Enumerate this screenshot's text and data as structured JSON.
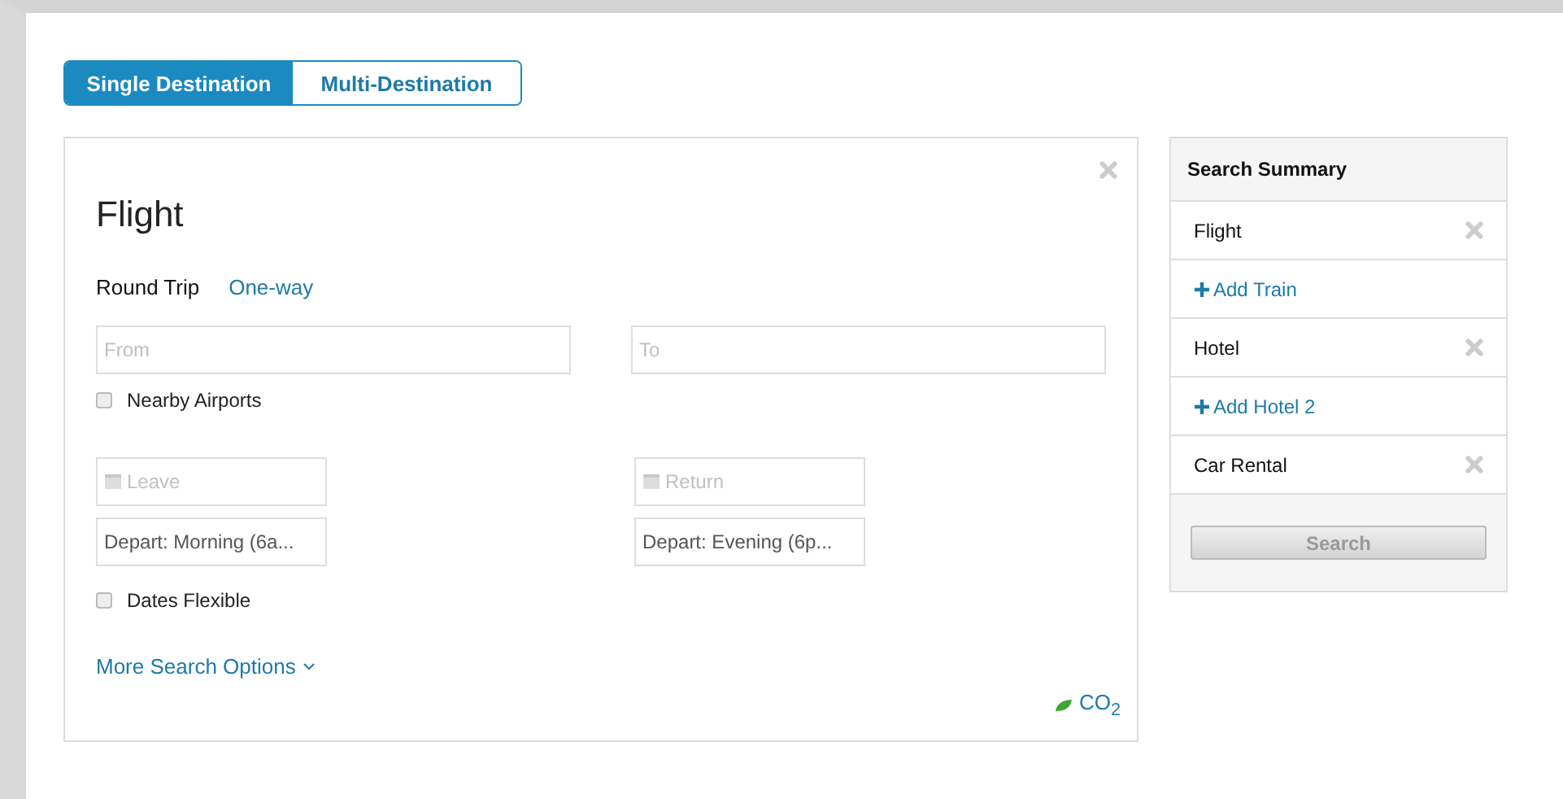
{
  "mode_tabs": [
    {
      "label": "Single Destination",
      "selected": true
    },
    {
      "label": "Multi-Destination",
      "selected": false
    }
  ],
  "flight": {
    "title": "Flight",
    "trip_types": [
      {
        "label": "Round Trip",
        "selected": true
      },
      {
        "label": "One-way",
        "selected": false
      }
    ],
    "from": {
      "placeholder": "From"
    },
    "to": {
      "placeholder": "To"
    },
    "nearby_airports": {
      "label": "Nearby Airports",
      "checked": false
    },
    "leave": {
      "placeholder": "Leave"
    },
    "return": {
      "placeholder": "Return"
    },
    "depart_time": {
      "value": "Depart: Morning (6a..."
    },
    "return_time": {
      "value": "Depart: Evening (6p..."
    },
    "dates_flexible": {
      "label": "Dates Flexible",
      "checked": false
    },
    "more_options": "More Search Options",
    "co2": "CO$_{2}$"
  },
  "summary": {
    "title": "Search Summary",
    "items": [
      {
        "kind": "item",
        "label": "Flight"
      },
      {
        "kind": "add",
        "label": "Add Train"
      },
      {
        "kind": "item",
        "label": "Hotel"
      },
      {
        "kind": "add",
        "label": "Add Hotel 2"
      },
      {
        "kind": "item",
        "label": "Car Rental"
      }
    ],
    "search_button": {
      "label": "Search",
      "disabled": true
    }
  }
}
